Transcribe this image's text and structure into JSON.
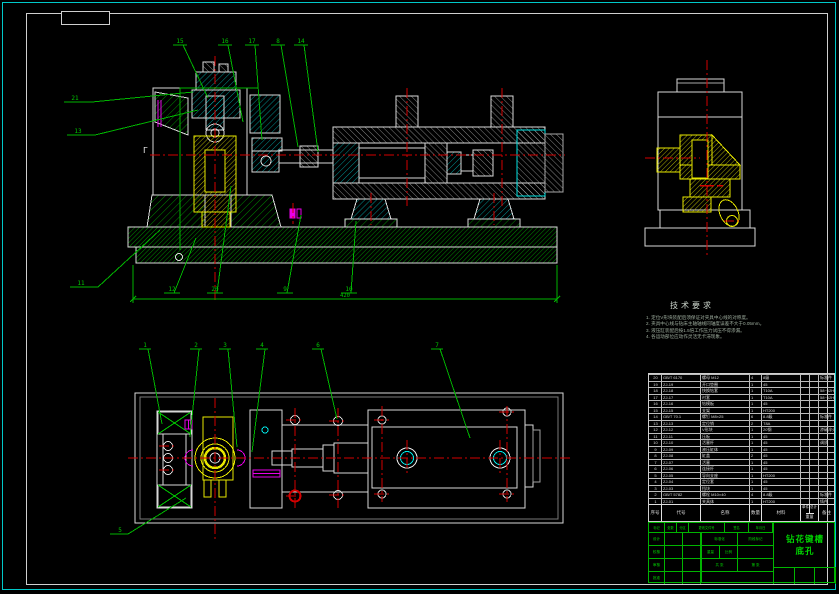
{
  "views": {
    "front_section_mark": "Γ"
  },
  "balloons": {
    "front_top": [
      "15",
      "16",
      "17",
      "8",
      "14"
    ],
    "front_left": [
      "21",
      "13"
    ],
    "front_bottom_left": "11",
    "front_bottom": [
      "12",
      "20",
      "9",
      "10"
    ],
    "plan_top": [
      "1",
      "2",
      "3",
      "4",
      "6",
      "7"
    ],
    "plan_bottom_left": "5"
  },
  "dimensions": {
    "front_overall": "420"
  },
  "tech": {
    "title": "技术要求",
    "items": [
      "1. 定位V形块装配后须保证对夹具中心线的对称度。",
      "2. 夹具中心线与钻床主轴轴线同轴度误差不大于0.05mm。",
      "3. 液压缸装配后按1.5倍工作压力试压不得渗漏。",
      "4. 各运动部位应动作灵活无卡滞现象。"
    ]
  },
  "bom": {
    "headers": {
      "no": "序号",
      "code": "代号",
      "name": "名称",
      "qty": "数量",
      "mat": "材料",
      "w1": "单件",
      "w2": "总计",
      "w": "重量",
      "remark": "备注"
    },
    "rows": [
      {
        "no": "1",
        "code": "ZJ-01",
        "name": "夹具体",
        "qty": "1",
        "mat": "HT200",
        "w1": "",
        "w2": "",
        "remark": "铸件"
      },
      {
        "no": "2",
        "code": "GB/T 5782",
        "name": "螺栓 M10×40",
        "qty": "4",
        "mat": "8.8级",
        "w1": "",
        "w2": "",
        "remark": "标准件"
      },
      {
        "no": "3",
        "code": "ZJ-03",
        "name": "挡块",
        "qty": "1",
        "mat": "45",
        "w1": "",
        "w2": "",
        "remark": ""
      },
      {
        "no": "4",
        "code": "ZJ-04",
        "name": "定位套",
        "qty": "1",
        "mat": "45",
        "w1": "",
        "w2": "",
        "remark": ""
      },
      {
        "no": "5",
        "code": "ZJ-05",
        "name": "导向支座",
        "qty": "1",
        "mat": "HT200",
        "w1": "",
        "w2": "",
        "remark": ""
      },
      {
        "no": "6",
        "code": "ZJ-06",
        "name": "连接杆",
        "qty": "1",
        "mat": "45",
        "w1": "",
        "w2": "",
        "remark": ""
      },
      {
        "no": "7",
        "code": "ZJ-07",
        "name": "活塞",
        "qty": "1",
        "mat": "45",
        "w1": "",
        "w2": "",
        "remark": ""
      },
      {
        "no": "8",
        "code": "ZJ-08",
        "name": "缸盖",
        "qty": "2",
        "mat": "45",
        "w1": "",
        "w2": "",
        "remark": ""
      },
      {
        "no": "9",
        "code": "ZJ-09",
        "name": "液压缸体",
        "qty": "1",
        "mat": "45",
        "w1": "",
        "w2": "",
        "remark": ""
      },
      {
        "no": "10",
        "code": "ZJ-10",
        "name": "活塞杆",
        "qty": "1",
        "mat": "45",
        "w1": "",
        "w2": "",
        "remark": "调质"
      },
      {
        "no": "11",
        "code": "ZJ-11",
        "name": "压板",
        "qty": "1",
        "mat": "45",
        "w1": "",
        "w2": "",
        "remark": ""
      },
      {
        "no": "12",
        "code": "ZJ-12",
        "name": "V形块",
        "qty": "1",
        "mat": "20钢",
        "w1": "",
        "w2": "",
        "remark": "渗碳淬火"
      },
      {
        "no": "13",
        "code": "ZJ-13",
        "name": "定位销",
        "qty": "2",
        "mat": "T8A",
        "w1": "",
        "w2": "",
        "remark": ""
      },
      {
        "no": "14",
        "code": "GB/T 70.1",
        "name": "螺钉 M8×25",
        "qty": "6",
        "mat": "8.8级",
        "w1": "",
        "w2": "",
        "remark": "标准件"
      },
      {
        "no": "15",
        "code": "ZJ-15",
        "name": "支架",
        "qty": "1",
        "mat": "HT200",
        "w1": "",
        "w2": "",
        "remark": ""
      },
      {
        "no": "16",
        "code": "ZJ-16",
        "name": "钻模板",
        "qty": "1",
        "mat": "45",
        "w1": "",
        "w2": "",
        "remark": ""
      },
      {
        "no": "17",
        "code": "ZJ-17",
        "name": "衬套",
        "qty": "1",
        "mat": "T10A",
        "w1": "",
        "w2": "",
        "remark": "58~62HRC"
      },
      {
        "no": "18",
        "code": "ZJ-18",
        "name": "快换钻套",
        "qty": "1",
        "mat": "T10A",
        "w1": "",
        "w2": "",
        "remark": "58~62HRC"
      },
      {
        "no": "19",
        "code": "ZJ-19",
        "name": "开口垫圈",
        "qty": "1",
        "mat": "45",
        "w1": "",
        "w2": "",
        "remark": ""
      },
      {
        "no": "20",
        "code": "GB/T 6170",
        "name": "螺母 M12",
        "qty": "4",
        "mat": "8级",
        "w1": "",
        "w2": "",
        "remark": "标准件"
      }
    ]
  },
  "titleblock": {
    "rev_row": [
      "标记",
      "处数",
      "分区",
      "更改文件号",
      "签名",
      "年月日"
    ],
    "sig_rows": [
      "设计",
      "校核",
      "审核",
      "批准"
    ],
    "std": "标准化",
    "stage": "阶段标记",
    "weight": "重量",
    "scale": "比例",
    "sheets": "共 张",
    "sheet_no": "第 张",
    "title_line1": "钻花键槽",
    "title_line2": "底孔"
  }
}
